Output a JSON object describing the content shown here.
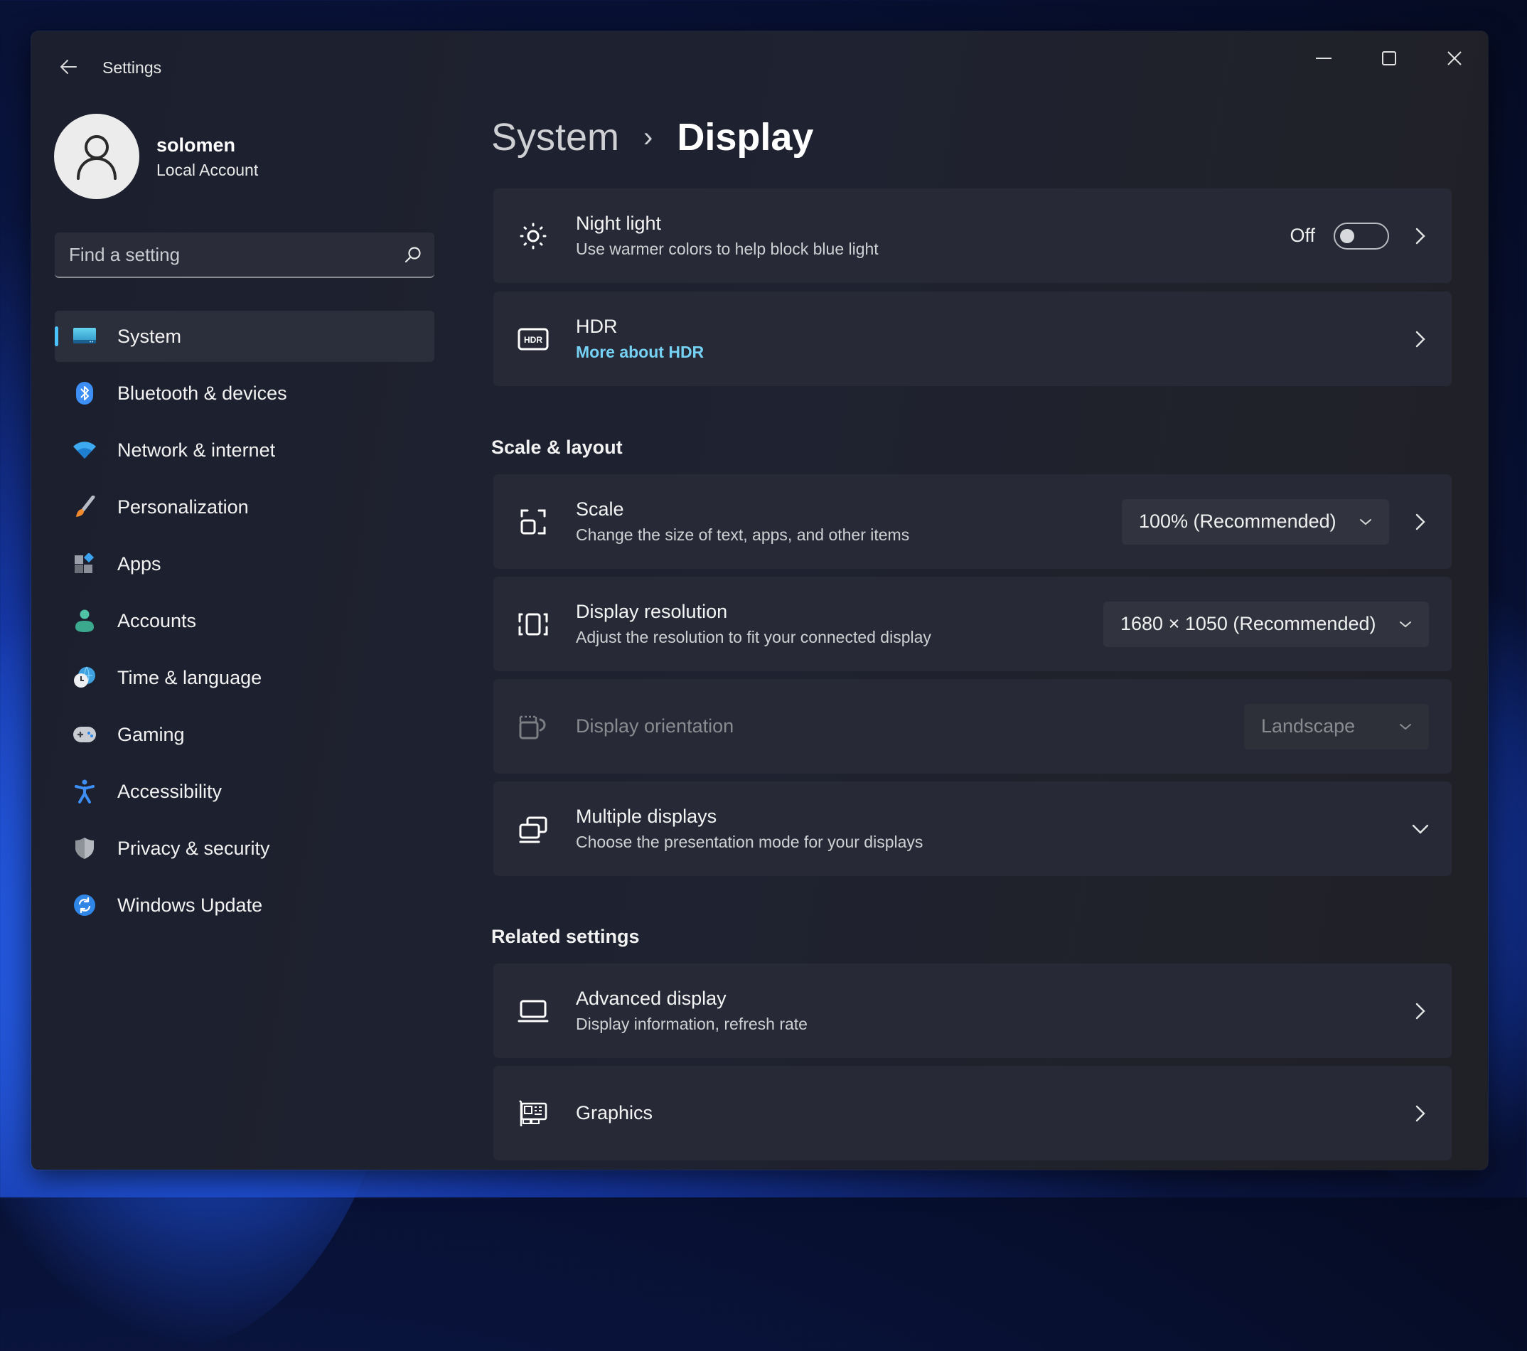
{
  "window": {
    "title": "Settings",
    "caption_buttons": {
      "minimize": "minimize-icon",
      "maximize": "maximize-icon",
      "close": "close-icon"
    }
  },
  "profile": {
    "name": "solomen",
    "account_type": "Local Account"
  },
  "search": {
    "placeholder": "Find a setting",
    "value": ""
  },
  "sidebar": {
    "active": "System",
    "items": [
      {
        "label": "System",
        "icon": "system-display-icon"
      },
      {
        "label": "Bluetooth & devices",
        "icon": "bluetooth-icon"
      },
      {
        "label": "Network & internet",
        "icon": "wifi-icon"
      },
      {
        "label": "Personalization",
        "icon": "paintbrush-icon"
      },
      {
        "label": "Apps",
        "icon": "apps-icon"
      },
      {
        "label": "Accounts",
        "icon": "account-person-icon"
      },
      {
        "label": "Time & language",
        "icon": "globe-clock-icon"
      },
      {
        "label": "Gaming",
        "icon": "gamepad-icon"
      },
      {
        "label": "Accessibility",
        "icon": "accessibility-icon"
      },
      {
        "label": "Privacy & security",
        "icon": "shield-icon"
      },
      {
        "label": "Windows Update",
        "icon": "windows-update-icon"
      }
    ]
  },
  "breadcrumb": {
    "parent": "System",
    "separator": "›",
    "current": "Display"
  },
  "cards": {
    "night_light": {
      "title": "Night light",
      "subtitle": "Use warmer colors to help block blue light",
      "toggle_state_label": "Off",
      "toggle_on": false
    },
    "hdr": {
      "title": "HDR",
      "link": "More about HDR"
    },
    "scale": {
      "title": "Scale",
      "subtitle": "Change the size of text, apps, and other items",
      "value": "100% (Recommended)"
    },
    "resolution": {
      "title": "Display resolution",
      "subtitle": "Adjust the resolution to fit your connected display",
      "value": "1680 × 1050 (Recommended)"
    },
    "orientation": {
      "title": "Display orientation",
      "value": "Landscape",
      "disabled": true
    },
    "multiple_displays": {
      "title": "Multiple displays",
      "subtitle": "Choose the presentation mode for your displays"
    },
    "advanced_display": {
      "title": "Advanced display",
      "subtitle": "Display information, refresh rate"
    },
    "graphics": {
      "title": "Graphics"
    }
  },
  "sections": {
    "scale_layout": "Scale & layout",
    "related_settings": "Related settings"
  },
  "colors": {
    "accent": "#4cc2ff",
    "link": "#76d2f5",
    "window_bg": "#1e202c",
    "card_bg": "#272a36"
  }
}
